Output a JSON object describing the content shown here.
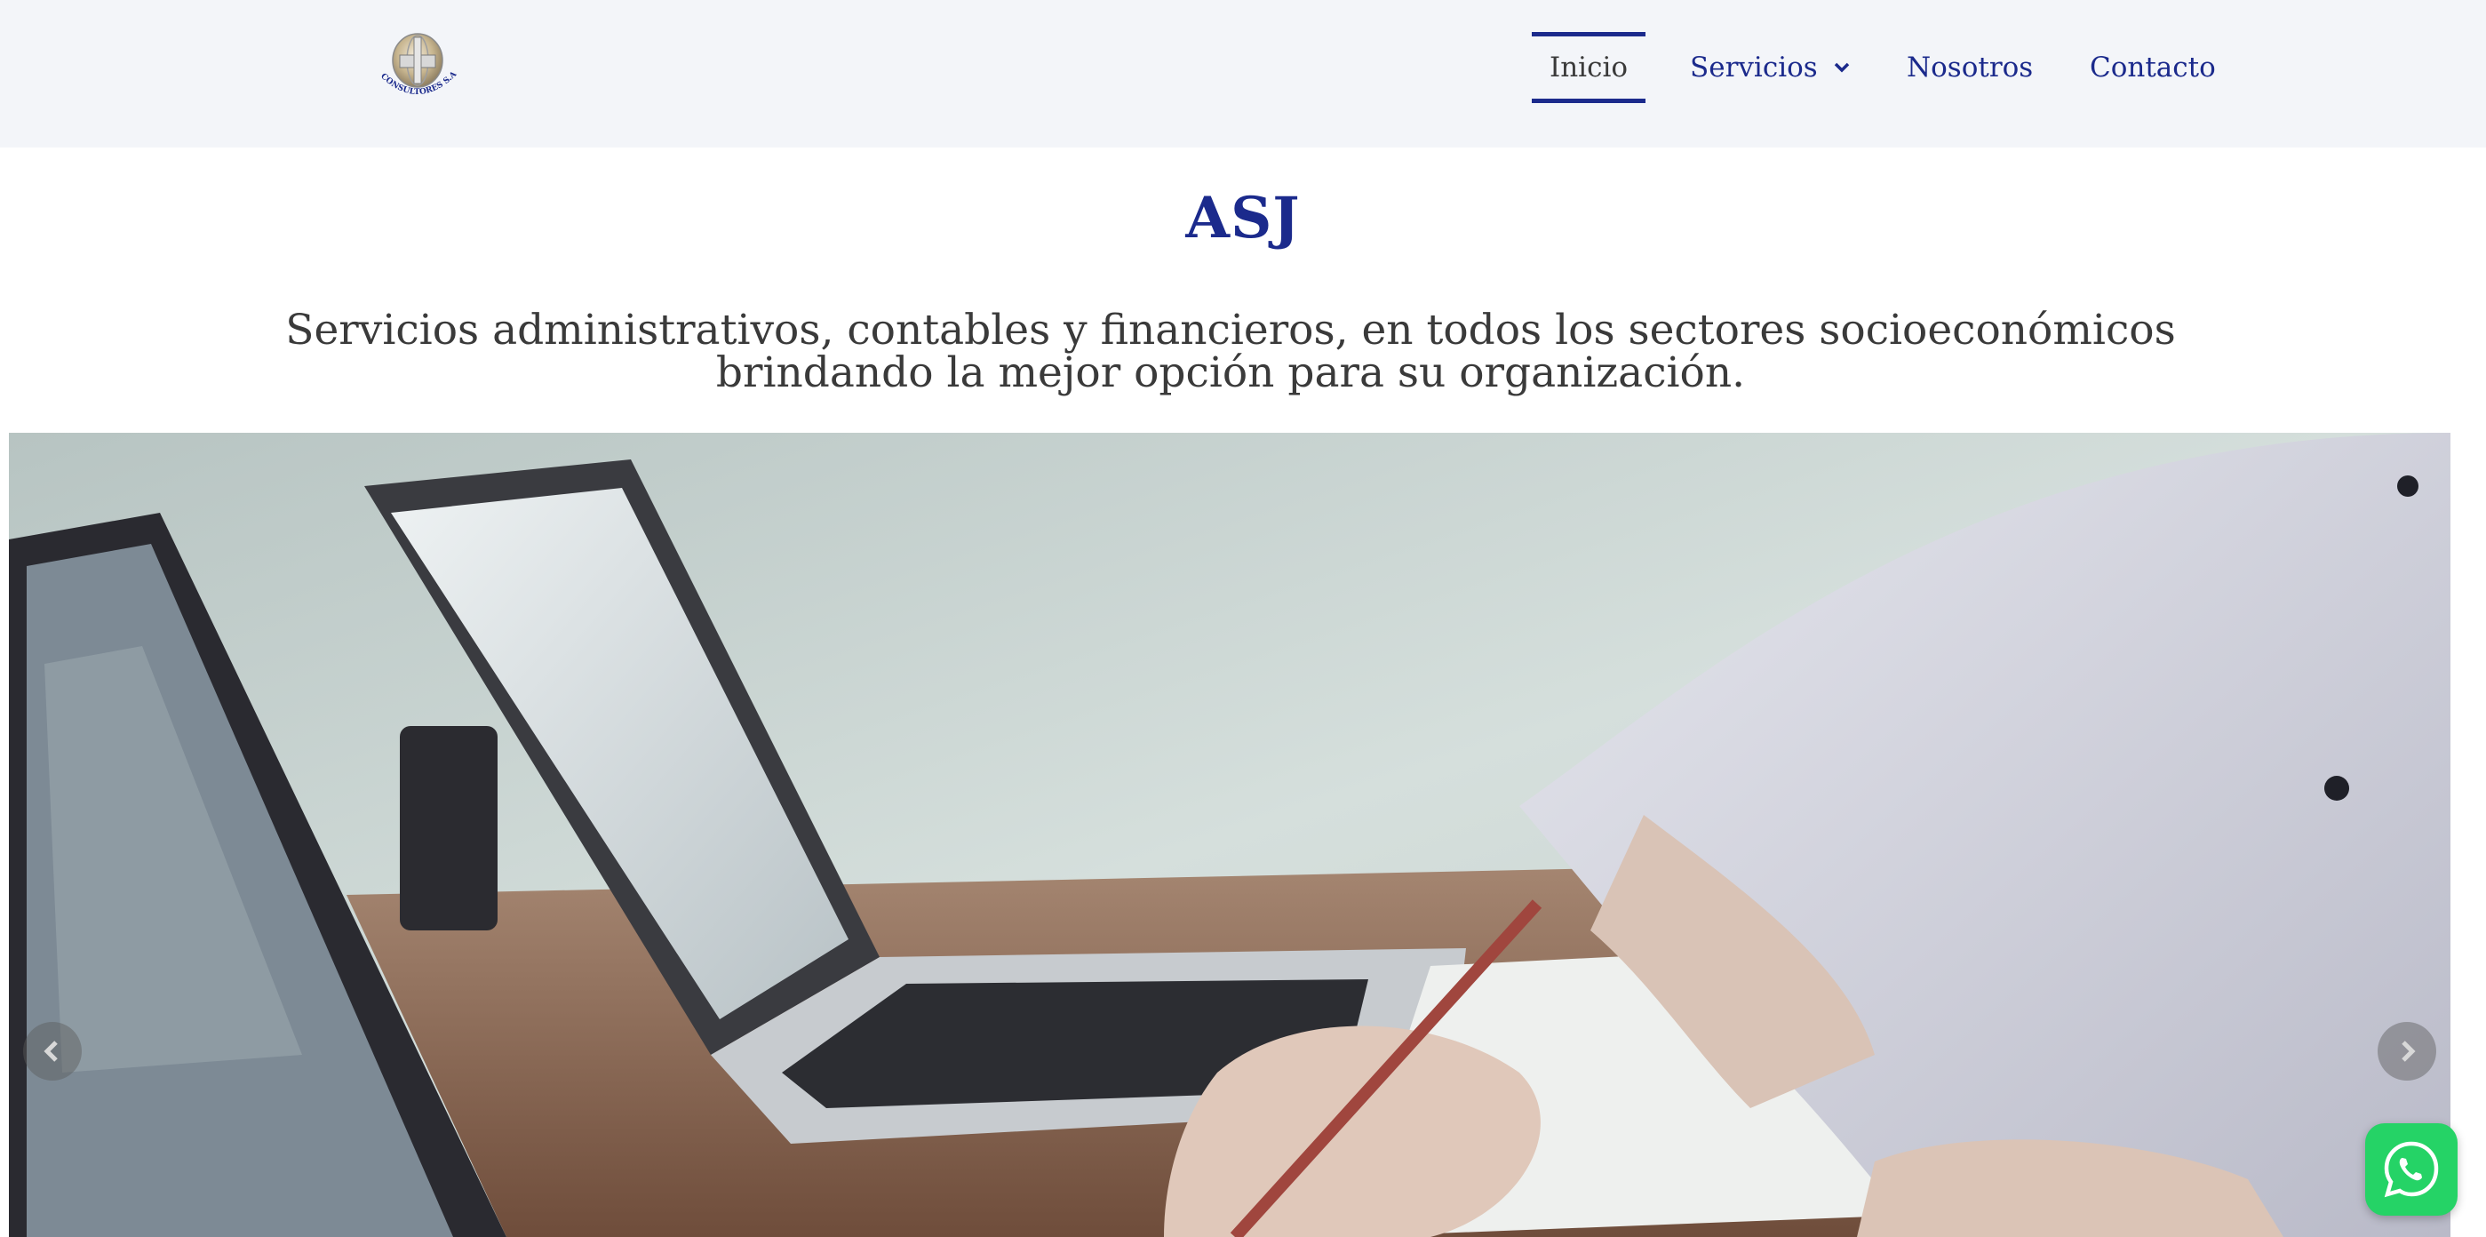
{
  "header": {
    "logo": {
      "alt": "ASJ Consultores S.A.S",
      "text": "CONSULTORES S.A.S",
      "icon": "logo-icon"
    },
    "nav": [
      {
        "label": "Inicio",
        "active": true
      },
      {
        "label": "Servicios",
        "has_dropdown": true,
        "icon": "chevron-down-icon"
      },
      {
        "label": "Nosotros"
      },
      {
        "label": "Contacto"
      }
    ]
  },
  "hero_text": {
    "title": "ASJ",
    "subtitle": "Servicios administrativos, contables y financieros, en todos los sectores socioeconómicos brindando la mejor opción para su organización."
  },
  "slider": {
    "prev_icon": "chevron-left-icon",
    "next_icon": "chevron-right-icon"
  },
  "whatsapp": {
    "icon": "whatsapp-icon",
    "color": "#25d366"
  },
  "colors": {
    "brand": "#1b2a8c",
    "text": "#3a3a3a",
    "header_bg": "#f3f5f9"
  }
}
